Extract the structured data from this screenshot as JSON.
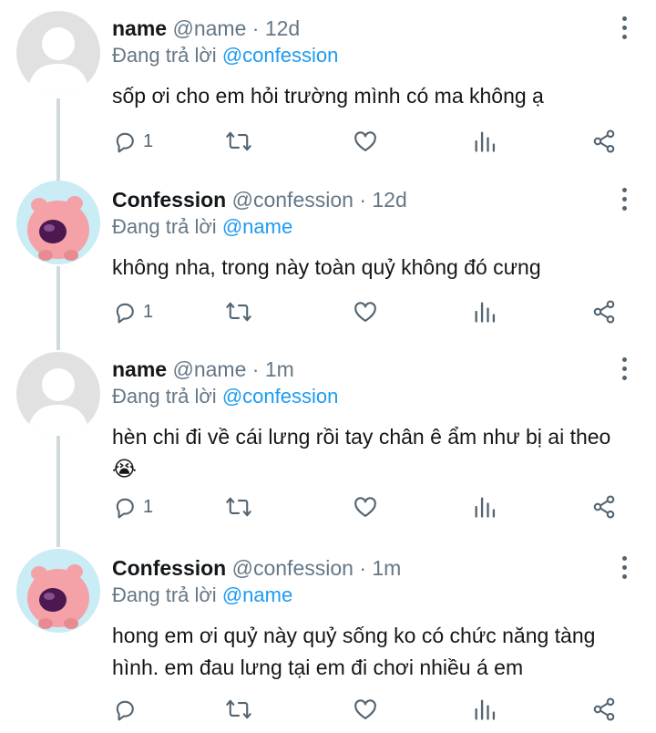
{
  "tweets": [
    {
      "display_name": "name",
      "handle": "@name",
      "separator": "·",
      "time": "12d",
      "replying_prefix": "Đang trả lời",
      "replying_to": "@confession",
      "text": "sốp ơi cho em hỏi trường mình có ma không ạ",
      "reply_count": "1",
      "avatar": "default-avatar"
    },
    {
      "display_name": "Confession",
      "handle": "@confession",
      "separator": "·",
      "time": "12d",
      "replying_prefix": "Đang trả lời",
      "replying_to": "@name",
      "text": "không nha, trong này toàn quỷ không đó cưng",
      "reply_count": "1",
      "avatar": "pink-pig-avatar"
    },
    {
      "display_name": "name",
      "handle": "@name",
      "separator": "·",
      "time": "1m",
      "replying_prefix": "Đang trả lời",
      "replying_to": "@confession",
      "text": "hèn chi đi về cái lưng rồi tay chân ê ẩm như bị ai theo 😭",
      "reply_count": "1",
      "avatar": "default-avatar"
    },
    {
      "display_name": "Confession",
      "handle": "@confession",
      "separator": "·",
      "time": "1m",
      "replying_prefix": "Đang trả lời",
      "replying_to": "@name",
      "text": "hong em ơi quỷ này quỷ sống ko có chức năng tàng hình. em đau lưng tại em đi chơi nhiều á em",
      "reply_count": "",
      "avatar": "pink-pig-avatar"
    }
  ],
  "icons": {
    "reply": "reply-icon",
    "retweet": "retweet-icon",
    "like": "heart-icon",
    "stats": "stats-icon",
    "share": "share-icon",
    "more": "more-options-icon"
  },
  "colors": {
    "mention": "#1d9bf0",
    "secondary_text": "#657786",
    "thread_line": "#cfd9de",
    "avatar_default_bg": "#e1e1e1",
    "avatar_pig_bg": "#c9ecf5",
    "pig_pink": "#f4a2a8"
  }
}
